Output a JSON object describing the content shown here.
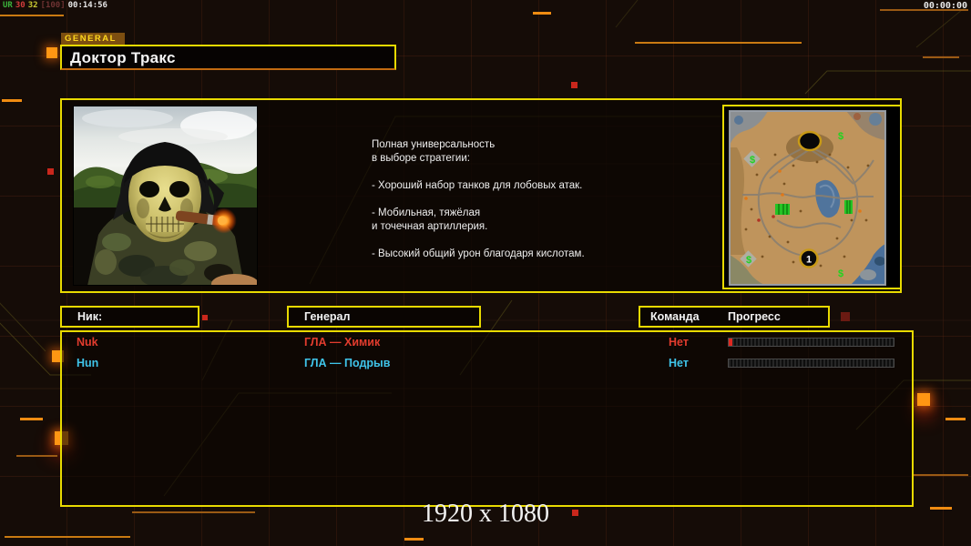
{
  "hud": {
    "net": {
      "tag": "UR",
      "val1": "30",
      "val2": "32",
      "val3": "[100]",
      "elapsed": "00:14:56"
    },
    "clock": "00:00:00"
  },
  "header": {
    "tab_label": "GENERAL",
    "title": "Доктор Тракс"
  },
  "profile": {
    "description_paragraphs": [
      "Полная универсальность\nв выборе стратегии:",
      "- Хороший набор танков для лобовых атак.",
      "- Мобильная, тяжёлая\nи точечная артиллерия.",
      "- Высокий общий урон благодаря кислотам."
    ]
  },
  "minimap": {
    "start_marker_label": "1",
    "supply_marker": "$"
  },
  "players": {
    "headers": {
      "nick": "Ник:",
      "general": "Генерал",
      "team": "Команда",
      "progress": "Прогресс"
    },
    "rows": [
      {
        "nick": "Nuk",
        "general": "ГЛА — Химик",
        "team": "Нет",
        "color": "#e23c2e",
        "progress_percent": 2
      },
      {
        "nick": "Hun",
        "general": "ГЛА — Подрыв",
        "team": "Нет",
        "color": "#3fc4ea",
        "progress_percent": 0
      }
    ]
  },
  "footer": {
    "resolution_label": "1920 x 1080"
  },
  "theme": {
    "panel_border": "#e8da00",
    "accent_orange": "#f28c0e",
    "accent_red": "#c9271c",
    "progress_fill_red": "#e02820"
  }
}
